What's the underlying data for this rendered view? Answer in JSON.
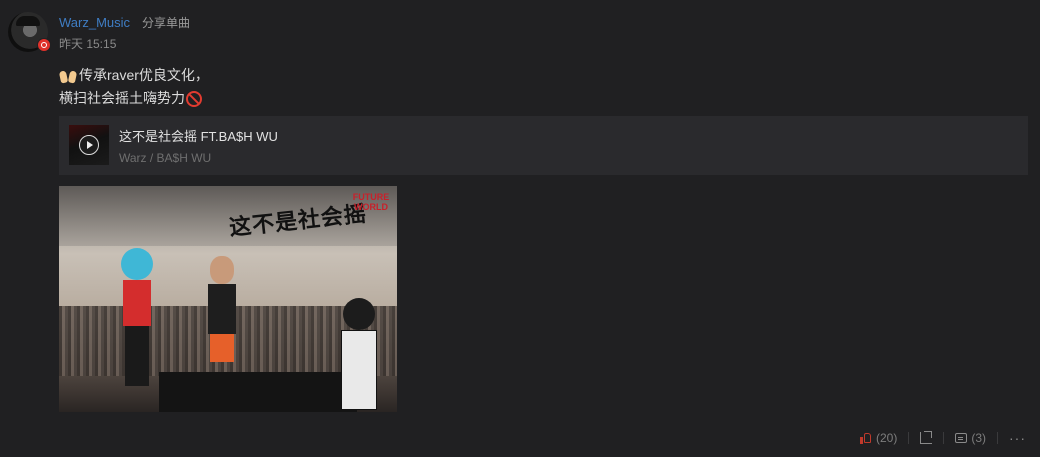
{
  "user": {
    "name": "Warz_Music",
    "action": "分享单曲",
    "time": "昨天 15:15"
  },
  "post": {
    "line1": "传承raver优良文化，",
    "line2": "横扫社会摇土嗨势力",
    "emoji1": "raising-hands-icon",
    "emoji2": "prohibited-icon"
  },
  "song": {
    "title": "这不是社会摇 FT.BA$H WU",
    "artist": "Warz / BA$H WU"
  },
  "image": {
    "headline": "这不是社会摇",
    "logo": "FUTURE WORLD"
  },
  "actions": {
    "like_count": "(20)",
    "comment_count": "(3)",
    "more": "···"
  },
  "colors": {
    "background": "#202022",
    "username": "#3f7dc4",
    "card": "#2a2a2d",
    "like": "#c0392b"
  }
}
